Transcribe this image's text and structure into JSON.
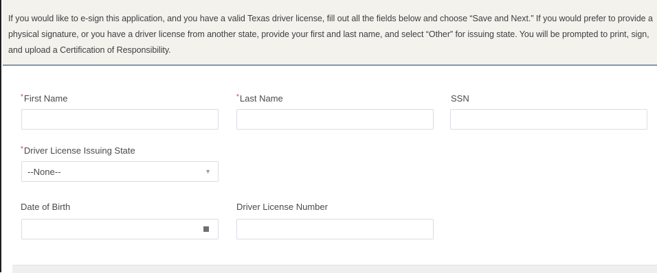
{
  "intro_text": "If you would like to e-sign this application, and you have a valid Texas driver license, fill out all the fields below and choose “Save and Next.” If you would prefer to provide a physical signature, or you have a driver license from another state, provide your first and last name, and select “Other” for issuing state. You will be prompted to print, sign, and upload a Certification of Responsibility.",
  "form": {
    "required_marker": "*",
    "first_name": {
      "label": "First Name",
      "value": ""
    },
    "last_name": {
      "label": "Last Name",
      "value": ""
    },
    "ssn": {
      "label": "SSN",
      "value": ""
    },
    "license_state": {
      "label": "Driver License Issuing State",
      "selected": "--None--"
    },
    "dob": {
      "label": "Date of Birth",
      "value": ""
    },
    "license_number": {
      "label": "Driver License Number",
      "value": ""
    }
  },
  "icons": {
    "calendar": "calendar-icon",
    "dropdown": "chevron-down-icon"
  }
}
